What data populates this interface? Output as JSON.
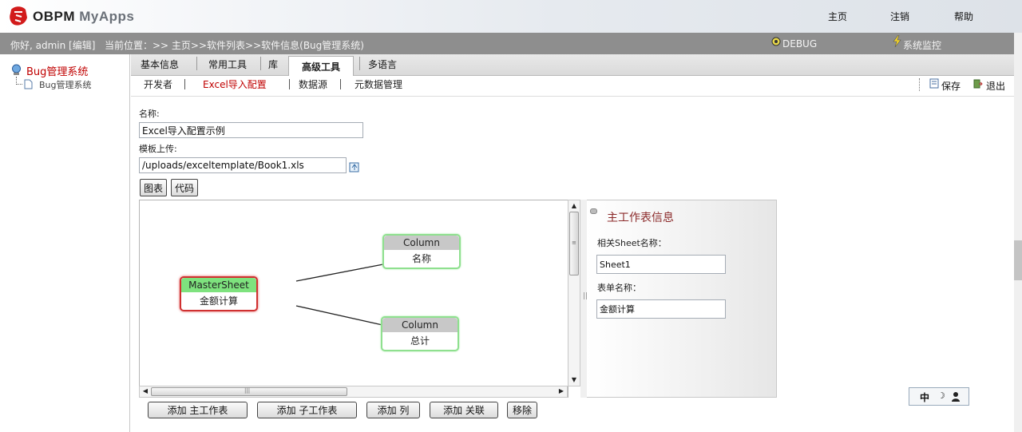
{
  "header": {
    "app_name": "OBPM",
    "app_sub": "MyApps",
    "nav": [
      "主页",
      "注销",
      "帮助"
    ]
  },
  "statusbar": {
    "greeting": "你好, admin [编辑]",
    "location": "当前位置：>> 主页>>软件列表>>软件信息(Bug管理系统)",
    "debug": "DEBUG",
    "monitor": "系统监控"
  },
  "tree": {
    "root": "Bug管理系统",
    "child": "Bug管理系统"
  },
  "tabs": {
    "basic": "基本信息",
    "tools": "常用工具",
    "lib": "库",
    "advanced": "高级工具",
    "lang": "多语言"
  },
  "subtabs": {
    "developer": "开发者",
    "excel": "Excel导入配置",
    "datasource": "数据源",
    "metadata": "元数据管理",
    "save": "保存",
    "exit": "退出"
  },
  "form": {
    "name_label": "名称:",
    "name_value": "Excel导入配置示例",
    "template_label": "模板上传:",
    "template_value": "/uploads/exceltemplate/Book1.xls",
    "chart_btn": "图表",
    "code_btn": "代码"
  },
  "diagram": {
    "master_type": "MasterSheet",
    "master_name": "金额计算",
    "col1_type": "Column",
    "col1_name": "名称",
    "col2_type": "Column",
    "col2_name": "总计"
  },
  "info": {
    "title": "主工作表信息",
    "sheet_label": "相关Sheet名称：",
    "sheet_value": "Sheet1",
    "form_label": "表单名称：",
    "form_value": "金额计算"
  },
  "actions": {
    "add_master": "添加 主工作表",
    "add_sub": "添加 子工作表",
    "add_col": "添加 列",
    "add_rel": "添加 关联",
    "remove": "移除"
  },
  "ime": {
    "mode": "中"
  },
  "colors": {
    "accent_red": "#c00000",
    "status_bg": "#8e8e8e",
    "master_head": "#7ee27e",
    "column_head": "#c8c8c8"
  }
}
